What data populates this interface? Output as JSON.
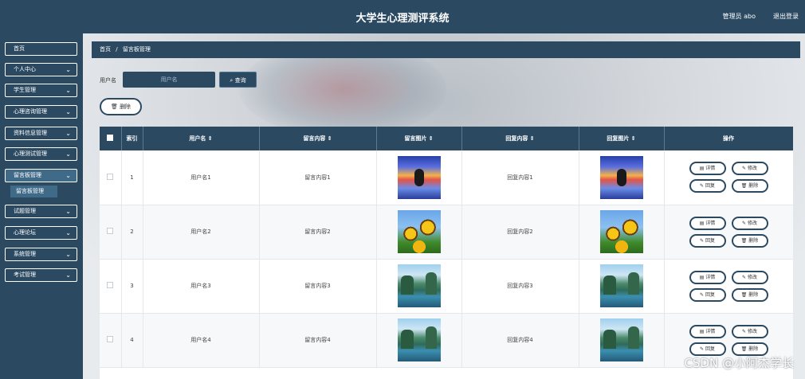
{
  "header": {
    "title": "大学生心理测评系统",
    "user": "管理员 abo",
    "logout": "退出登录"
  },
  "sidebar": {
    "items": [
      {
        "label": "首页",
        "has_chevron": false
      },
      {
        "label": "个人中心",
        "has_chevron": true
      },
      {
        "label": "学生管理",
        "has_chevron": true
      },
      {
        "label": "心理咨询管理",
        "has_chevron": true
      },
      {
        "label": "资料信息管理",
        "has_chevron": true
      },
      {
        "label": "心理测试管理",
        "has_chevron": true
      },
      {
        "label": "留言板管理",
        "has_chevron": true
      },
      {
        "label": "试题管理",
        "has_chevron": true
      },
      {
        "label": "心理论坛",
        "has_chevron": true
      },
      {
        "label": "系统管理",
        "has_chevron": true
      },
      {
        "label": "考试管理",
        "has_chevron": true
      }
    ],
    "sub_item": "留言板管理",
    "chevron_glyph": "⌄"
  },
  "breadcrumb": {
    "home": "首页",
    "sep": "/",
    "current": "留言板管理"
  },
  "search": {
    "label": "用户名",
    "placeholder": "用户名",
    "button": "查询",
    "delete_button": "删除"
  },
  "table": {
    "headers": [
      "索引",
      "用户名 ⇕",
      "留言内容 ⇕",
      "留言图片 ⇕",
      "回复内容 ⇕",
      "回复图片 ⇕",
      "操作"
    ],
    "rows": [
      {
        "index": "1",
        "username": "用户名1",
        "message": "留言内容1",
        "reply": "回复内容1",
        "image": "eclipse"
      },
      {
        "index": "2",
        "username": "用户名2",
        "message": "留言内容2",
        "reply": "回复内容2",
        "image": "sunflowers"
      },
      {
        "index": "3",
        "username": "用户名3",
        "message": "留言内容3",
        "reply": "回复内容3",
        "image": "lake"
      },
      {
        "index": "4",
        "username": "用户名4",
        "message": "留言内容4",
        "reply": "回复内容4",
        "image": "lake"
      }
    ],
    "actions": {
      "detail": "详情",
      "edit": "修改",
      "reply": "回复",
      "delete": "删除"
    }
  },
  "watermark": "CSDN @小阿杰学长",
  "colors": {
    "primary": "#2b4a62",
    "active": "#3f6a88"
  }
}
